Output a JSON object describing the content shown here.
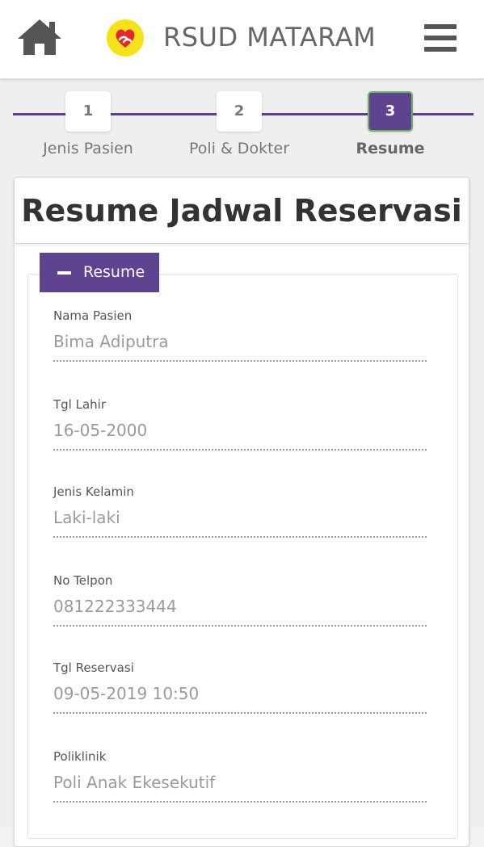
{
  "header": {
    "brand_title": "RSUD MATARAM",
    "home_icon": "home-icon",
    "menu_icon": "hamburger-menu-icon",
    "logo_icon": "heart-hands-logo"
  },
  "colors": {
    "accent": "#5f4391",
    "active_border": "#6fb45d",
    "logo_yellow": "#f6e21b",
    "logo_red": "#e2282b"
  },
  "stepper": {
    "steps": [
      {
        "number": "1",
        "label": "Jenis Pasien",
        "active": false
      },
      {
        "number": "2",
        "label": "Poli & Dokter",
        "active": false
      },
      {
        "number": "3",
        "label": "Resume",
        "active": true
      }
    ]
  },
  "card": {
    "title": "Resume Jadwal Reservasi"
  },
  "panel": {
    "tab_label": "Resume",
    "tab_icon": "minus-icon",
    "fields": [
      {
        "label": "Nama Pasien",
        "value": "Bima Adiputra"
      },
      {
        "label": "Tgl Lahir",
        "value": "16-05-2000"
      },
      {
        "label": "Jenis Kelamin",
        "value": "Laki-laki"
      },
      {
        "label": "No Telpon",
        "value": "081222333444"
      },
      {
        "label": "Tgl Reservasi",
        "value": "09-05-2019 10:50"
      },
      {
        "label": "Poliklinik",
        "value": "Poli Anak Ekesekutif"
      }
    ]
  }
}
